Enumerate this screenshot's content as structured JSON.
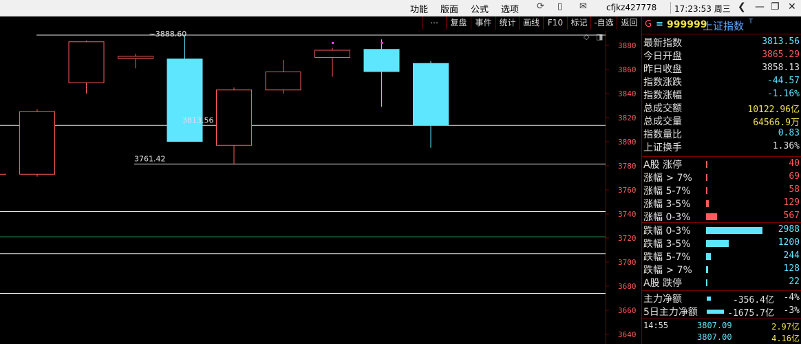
{
  "menu": {
    "items": [
      "功能",
      "版面",
      "公式",
      "选项"
    ]
  },
  "user": "cfjkz427778",
  "clock": "17:23:53 周三",
  "toolbar": {
    "items": [
      "复盘",
      "事件",
      "统计",
      "画线",
      "F10",
      "标记",
      "-自选",
      "返回"
    ]
  },
  "stock": {
    "marker": "G",
    "menu_glyph": "≡",
    "code": "999999",
    "name": "上证指数",
    "suffix": "T"
  },
  "quote": [
    {
      "label": "最新指数",
      "value": "3813.56",
      "color": "#5fe6ff"
    },
    {
      "label": "今日开盘",
      "value": "3865.29",
      "color": "#ff5a5a"
    },
    {
      "label": "昨日收盘",
      "value": "3858.13",
      "color": "#e0e0e0"
    },
    {
      "label": "指数涨跌",
      "value": "-44.57",
      "color": "#5fe6ff"
    },
    {
      "label": "指数涨幅",
      "value": "-1.16%",
      "color": "#5fe6ff"
    },
    {
      "label": "总成交额",
      "value": "10122.96亿",
      "color": "#f2e24d"
    },
    {
      "label": "总成交量",
      "value": "64566.9万",
      "color": "#f2e24d"
    },
    {
      "label": "指数量比",
      "value": "0.83",
      "color": "#5fe6ff"
    },
    {
      "label": "上证换手",
      "value": "1.36%",
      "color": "#e0e0e0"
    }
  ],
  "breadth_up": [
    {
      "label": "A股 涨停",
      "value": "40",
      "fraction": 0.01
    },
    {
      "label": "涨幅 > 7%",
      "value": "69",
      "fraction": 0.02
    },
    {
      "label": "涨幅 5-7%",
      "value": "58",
      "fraction": 0.02
    },
    {
      "label": "涨幅 3-5%",
      "value": "129",
      "fraction": 0.045
    },
    {
      "label": "涨幅 0-3%",
      "value": "567",
      "fraction": 0.195
    }
  ],
  "breadth_down": [
    {
      "label": "跌幅 0-3%",
      "value": "2988",
      "fraction": 1.0
    },
    {
      "label": "跌幅 3-5%",
      "value": "1200",
      "fraction": 0.4
    },
    {
      "label": "跌幅 5-7%",
      "value": "244",
      "fraction": 0.08
    },
    {
      "label": "跌幅 > 7%",
      "value": "128",
      "fraction": 0.04
    },
    {
      "label": "A股 跌停",
      "value": "22",
      "fraction": 0.01
    }
  ],
  "flow": [
    {
      "label": "主力净额",
      "value": "-356.4亿",
      "pct": "-4%",
      "fraction": 0.07
    },
    {
      "label": "5日主力净额",
      "value": "-1675.7亿",
      "pct": "-3%",
      "fraction": 0.3
    }
  ],
  "ticks": [
    {
      "time": "14:55",
      "price": "3807.09",
      "vol": "2.97亿"
    },
    {
      "time": "",
      "price": "3807.00",
      "vol": "4.16亿"
    }
  ],
  "colors": {
    "up": "#ff5a5a",
    "down": "#5fe6ff",
    "axis": "#7a0000",
    "flat": "#f2e24d",
    "text": "#e0e0e0"
  },
  "chart_data": {
    "type": "candlestick",
    "y_ticks": [
      "3880",
      "3860",
      "3840",
      "3820",
      "3800",
      "3780",
      "3760",
      "3740",
      "3720",
      "3700",
      "3680",
      "3660",
      "3640"
    ],
    "ylim": [
      3632,
      3892
    ],
    "candles": [
      {
        "open": 3773,
        "close": 3825,
        "high": 3827,
        "low": 3771
      },
      {
        "open": 3849,
        "close": 3883,
        "high": 3884,
        "low": 3840
      },
      {
        "open": 3869,
        "close": 3871,
        "high": 3873,
        "low": 3861
      },
      {
        "open": 3869,
        "close": 3800,
        "high": 3888.6,
        "low": 3800
      },
      {
        "open": 3797,
        "close": 3843,
        "high": 3845,
        "low": 3781
      },
      {
        "open": 3843,
        "close": 3858,
        "high": 3868,
        "low": 3840
      },
      {
        "open": 3870,
        "close": 3876,
        "high": 3878,
        "low": 3854
      },
      {
        "open": 3877,
        "close": 3858,
        "high": 3885,
        "low": 3829
      },
      {
        "open": 3865.29,
        "close": 3813.56,
        "high": 3867,
        "low": 3795
      }
    ],
    "annotations": {
      "high_label": "3888.60",
      "low_label": "3761.42",
      "last_label": "3813.56"
    },
    "levels": [
      3888.6,
      3813.56,
      3781.5,
      3742,
      3721,
      3707,
      3674
    ]
  }
}
